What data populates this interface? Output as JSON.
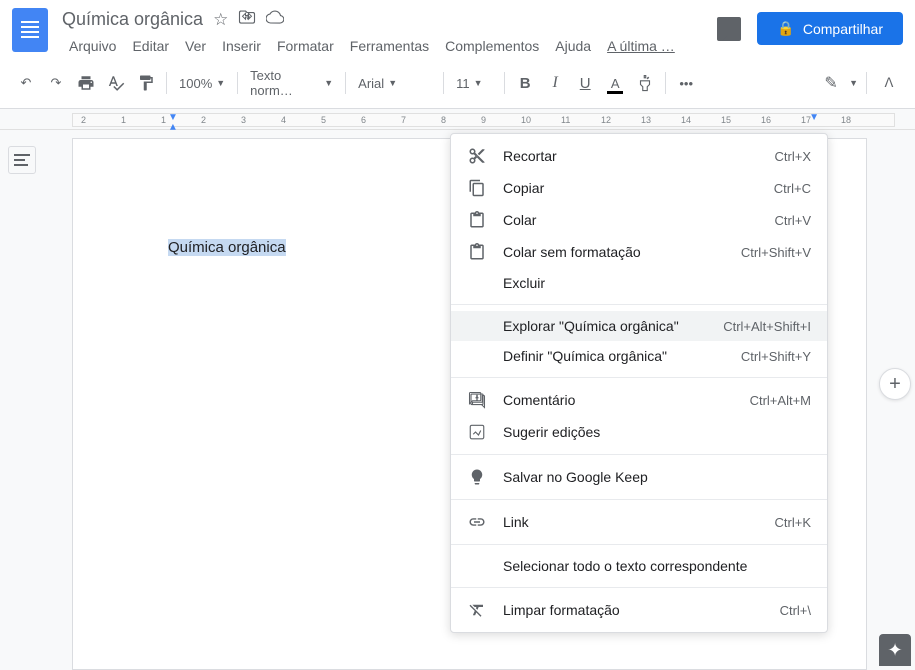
{
  "doc": {
    "title": "Química orgânica"
  },
  "menubar": [
    "Arquivo",
    "Editar",
    "Ver",
    "Inserir",
    "Formatar",
    "Ferramentas",
    "Complementos",
    "Ajuda"
  ],
  "last_edit": "A última …",
  "share_label": "Compartilhar",
  "toolbar": {
    "zoom": "100%",
    "style": "Texto norm…",
    "font": "Arial",
    "size": "11"
  },
  "ruler_marks": [
    "2",
    "1",
    "1",
    "2",
    "3",
    "4",
    "5",
    "6",
    "7",
    "8",
    "9",
    "10",
    "11",
    "12",
    "13",
    "14",
    "15",
    "16",
    "17",
    "18"
  ],
  "document": {
    "selected_text": "Química orgânica"
  },
  "context_menu": {
    "items": [
      {
        "icon": "cut",
        "label": "Recortar",
        "shortcut": "Ctrl+X"
      },
      {
        "icon": "copy",
        "label": "Copiar",
        "shortcut": "Ctrl+C"
      },
      {
        "icon": "paste",
        "label": "Colar",
        "shortcut": "Ctrl+V"
      },
      {
        "icon": "paste-plain",
        "label": "Colar sem formatação",
        "shortcut": "Ctrl+Shift+V"
      },
      {
        "icon": "",
        "label": "Excluir",
        "shortcut": ""
      },
      {
        "sep": true
      },
      {
        "icon": "",
        "label": "Explorar \"Química orgânica\"",
        "shortcut": "Ctrl+Alt+Shift+I",
        "highlighted": true
      },
      {
        "icon": "",
        "label": "Definir \"Química orgânica\"",
        "shortcut": "Ctrl+Shift+Y"
      },
      {
        "sep": true
      },
      {
        "icon": "comment",
        "label": "Comentário",
        "shortcut": "Ctrl+Alt+M"
      },
      {
        "icon": "suggest",
        "label": "Sugerir edições",
        "shortcut": ""
      },
      {
        "sep": true
      },
      {
        "icon": "keep",
        "label": "Salvar no Google Keep",
        "shortcut": ""
      },
      {
        "sep": true
      },
      {
        "icon": "link",
        "label": "Link",
        "shortcut": "Ctrl+K"
      },
      {
        "sep": true
      },
      {
        "icon": "",
        "label": "Selecionar todo o texto correspondente",
        "shortcut": ""
      },
      {
        "sep": true
      },
      {
        "icon": "clear",
        "label": "Limpar formatação",
        "shortcut": "Ctrl+\\"
      }
    ]
  }
}
